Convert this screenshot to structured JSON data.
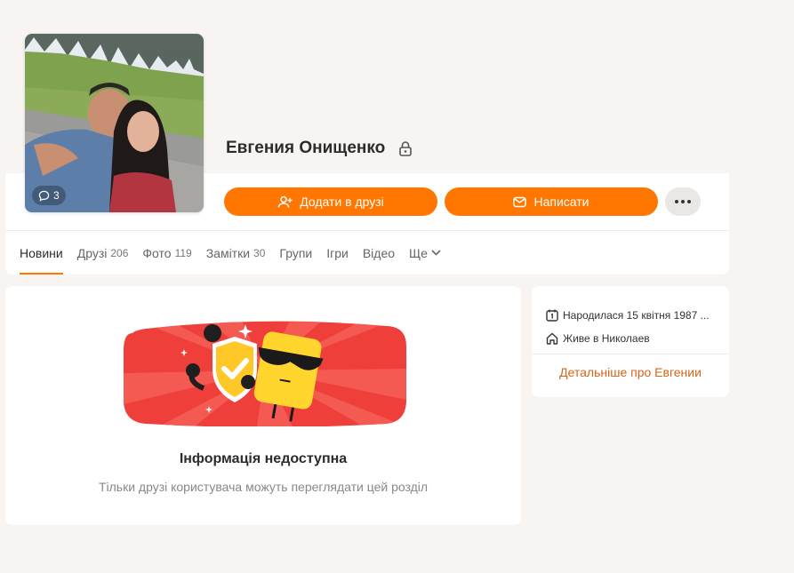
{
  "profile": {
    "name": "Евгения Онищенко",
    "comment_count": "3"
  },
  "actions": {
    "add_friend_label": "Додати в друзі",
    "write_label": "Написати"
  },
  "tabs": [
    {
      "label": "Новини",
      "count": ""
    },
    {
      "label": "Друзі",
      "count": "206"
    },
    {
      "label": "Фото",
      "count": "119"
    },
    {
      "label": "Замітки",
      "count": "30"
    },
    {
      "label": "Групи",
      "count": ""
    },
    {
      "label": "Ігри",
      "count": ""
    },
    {
      "label": "Відео",
      "count": ""
    },
    {
      "label": "Ще",
      "count": ""
    }
  ],
  "info": {
    "title": "Інформація недоступна",
    "subtitle": "Тільки друзі користувача можуть переглядати цей розділ"
  },
  "about": {
    "birth": "Народилася 15 квітня 1987 ...",
    "lives": "Живе в Николаев",
    "more_link": "Детальніше про Евгении"
  },
  "colors": {
    "accent": "#ff7700",
    "page_bg": "#f7f4f1",
    "link": "#d5651a"
  }
}
